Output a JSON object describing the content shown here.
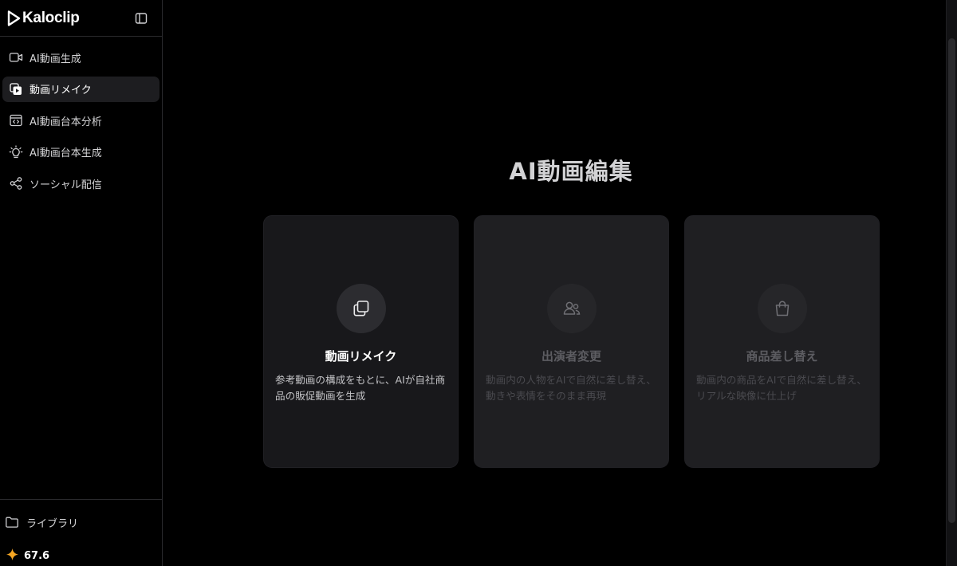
{
  "brand": {
    "name": "Kaloclip"
  },
  "sidebar": {
    "items": [
      {
        "label": "AI動画生成",
        "icon": "video-camera-icon",
        "active": false
      },
      {
        "label": "動画リメイク",
        "icon": "copy-play-icon",
        "active": true
      },
      {
        "label": "AI動画台本分析",
        "icon": "code-window-icon",
        "active": false
      },
      {
        "label": "AI動画台本生成",
        "icon": "lightbulb-icon",
        "active": false
      },
      {
        "label": "ソーシャル配信",
        "icon": "share-icon",
        "active": false
      }
    ],
    "library_label": "ライブラリ",
    "credits": "67.6"
  },
  "main": {
    "title": "AI動画編集",
    "cards": [
      {
        "title": "動画リメイク",
        "description": "参考動画の構成をもとに、AIが自社商品の販促動画を生成",
        "icon": "copy-icon",
        "enabled": true
      },
      {
        "title": "出演者変更",
        "description": "動画内の人物をAIで自然に差し替え、動きや表情をそのまま再現",
        "icon": "users-icon",
        "enabled": false
      },
      {
        "title": "商品差し替え",
        "description": "動画内の商品をAIで自然に差し替え、リアルな映像に仕上げ",
        "icon": "shopping-bag-icon",
        "enabled": false
      }
    ]
  },
  "colors": {
    "background": "#000000",
    "card": "#18181b",
    "active_nav": "#1d1d20",
    "credits_star": "#f5a623"
  }
}
